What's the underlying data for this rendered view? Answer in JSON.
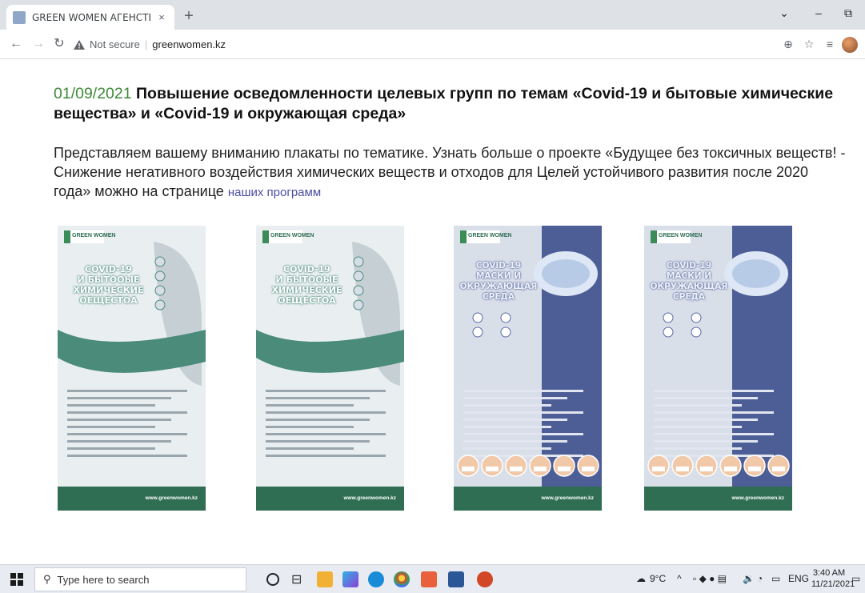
{
  "browser": {
    "tab_title": "GREEN WOMEN АГЕНСТВО ЭКО",
    "tab_close": "×",
    "new_tab": "+",
    "security_label": "Not secure",
    "address": "greenwomen.kz",
    "controls": {
      "menu": "⌄",
      "minimize": "–",
      "restore": "⧉"
    }
  },
  "article": {
    "date": "01/09/2021",
    "title": "Повышение осведомленности целевых групп по темам «Covid-19 и бытовые химические вещества» и «Covid-19 и окружающая среда»",
    "intro": "Представляем вашему вниманию плакаты по тематике. Узнать больше о проекте «Будущее без токсичных веществ! - Снижение негативного воздействия химических веществ и отходов для Целей устойчивого развития после 2020 года» можно на странице",
    "link_text": "наших программ"
  },
  "posters": [
    {
      "brand": "GREEN WOMEN",
      "title_lines": [
        "COVID-19",
        "И БЫТООЫЕ",
        "ХИМИЧЕСКИЕ",
        "ОЕЩЕСТОА"
      ],
      "footer_url": "www.greenwomen.kz",
      "theme": "#4a8b7a"
    },
    {
      "brand": "GREEN WOMEN",
      "title_lines": [
        "COVID-19",
        "И БЫТООЫЕ",
        "ХИМИЧЕСКИЕ",
        "ОЕЩЕСТОА"
      ],
      "footer_url": "www.greenwomen.kz",
      "theme": "#4a8b7a"
    },
    {
      "brand": "GREEN WOMEN",
      "title_lines": [
        "COVID-19",
        "МАСКИ И",
        "ОКРУЖАЮЩАЯ",
        "СРЕДА"
      ],
      "footer_url": "www.greenwomen.kz",
      "theme": "#5a6aa3"
    },
    {
      "brand": "GREEN WOMEN",
      "title_lines": [
        "COVID-19",
        "МАСКИ И",
        "ОКРУЖАЮЩАЯ",
        "СРЕДА"
      ],
      "footer_url": "www.greenwomen.kz",
      "theme": "#5a6aa3"
    }
  ],
  "taskbar": {
    "search_placeholder": "Type here to search",
    "temperature": "9°C",
    "language": "ENG",
    "time": "3:40 AM",
    "date": "11/21/2021"
  }
}
